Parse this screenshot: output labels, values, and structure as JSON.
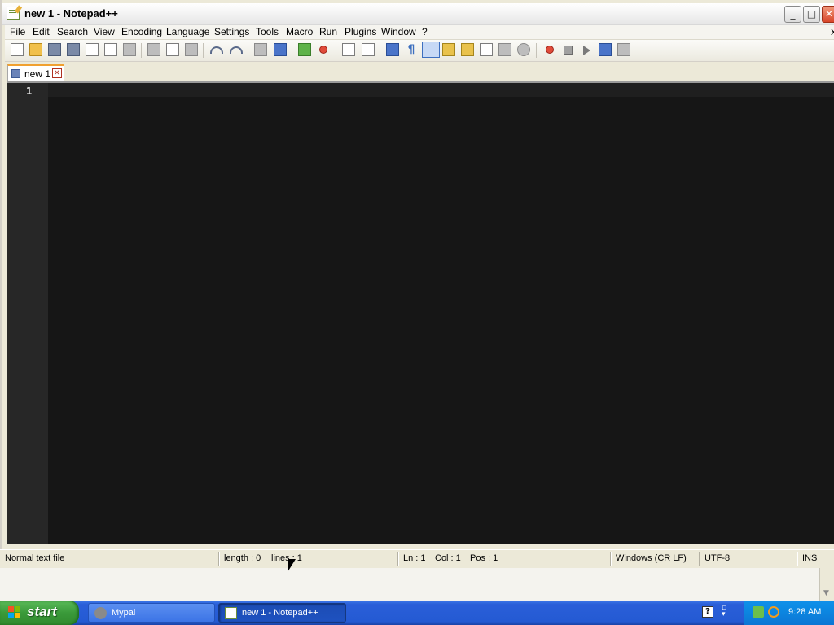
{
  "window": {
    "title": "new 1 - Notepad++",
    "minimize_glyph": "_",
    "maximize_glyph": "□",
    "close_glyph": "✕"
  },
  "menu": {
    "items": [
      {
        "label": "File"
      },
      {
        "label": "Edit"
      },
      {
        "label": "Search"
      },
      {
        "label": "View"
      },
      {
        "label": "Encoding"
      },
      {
        "label": "Language"
      },
      {
        "label": "Settings"
      },
      {
        "label": "Tools"
      },
      {
        "label": "Macro"
      },
      {
        "label": "Run"
      },
      {
        "label": "Plugins"
      },
      {
        "label": "Window"
      },
      {
        "label": "?"
      }
    ],
    "close_glyph": "x"
  },
  "toolbar": {
    "icons": [
      "new-file-icon",
      "open-file-icon",
      "save-icon",
      "save-all-icon",
      "close-icon",
      "close-all-icon",
      "print-icon",
      "cut-icon",
      "copy-icon",
      "paste-icon",
      "undo-icon",
      "redo-icon",
      "find-icon",
      "replace-icon",
      "zoom-in-icon",
      "zoom-out-icon",
      "sync-vertical-icon",
      "sync-horizontal-icon",
      "word-wrap-icon",
      "show-all-characters-icon",
      "indent-guide-icon",
      "user-defined-language-icon",
      "function-list-icon",
      "document-map-icon",
      "folder-as-workspace-icon",
      "monitoring-icon",
      "record-macro-icon",
      "stop-recording-icon",
      "playback-macro-icon",
      "run-macro-multiple-icon",
      "save-macro-icon"
    ],
    "pilcrow": "¶"
  },
  "tabs": [
    {
      "label": "new 1",
      "close_glyph": "×"
    }
  ],
  "editor": {
    "line_numbers": [
      "1"
    ],
    "content": "",
    "background": "#161616",
    "gutter_color": "#272727"
  },
  "statusbar": {
    "file_type": "Normal text file",
    "length": "length : 0",
    "lines": "lines : 1",
    "ln": "Ln : 1",
    "col": "Col : 1",
    "pos": "Pos : 1",
    "eol": "Windows (CR LF)",
    "encoding": "UTF-8",
    "mode": "INS"
  },
  "taskbar": {
    "start_label": "start",
    "tasks": [
      {
        "label": "Mypal",
        "icon": "mypal-icon",
        "active": false
      },
      {
        "label": "new 1 - Notepad++",
        "icon": "notepadpp-icon",
        "active": true
      }
    ],
    "help_glyph": "?",
    "clock": "9:28 AM"
  },
  "colors": {
    "taskbar_blue": "#245ad3",
    "start_green": "#3a9a3a",
    "tab_accent": "#f0a030"
  }
}
